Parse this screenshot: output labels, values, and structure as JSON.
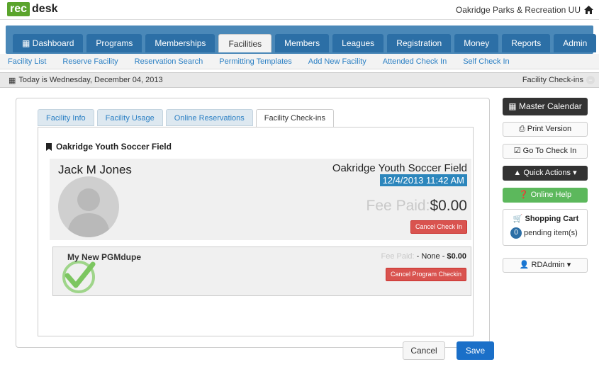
{
  "brand": {
    "rec": "rec",
    "desk": "desk"
  },
  "org": "Oakridge Parks & Recreation UU",
  "nav": {
    "tabs": [
      "Dashboard",
      "Programs",
      "Memberships",
      "Facilities",
      "Members",
      "Leagues",
      "Registration",
      "Money",
      "Reports",
      "Admin"
    ],
    "active": "Facilities"
  },
  "subnav": [
    "Facility List",
    "Reserve Facility",
    "Reservation Search",
    "Permitting Templates",
    "Add New Facility",
    "Attended Check In",
    "Self Check In"
  ],
  "datebar": {
    "today": "Today is Wednesday, December 04, 2013",
    "section": "Facility Check-ins"
  },
  "panel": {
    "tabs": [
      "Facility Info",
      "Facility Usage",
      "Online Reservations",
      "Facility Check-ins"
    ],
    "active_tab": "Facility Check-ins",
    "facility_title": "Oakridge Youth Soccer Field",
    "checkin": {
      "person": "Jack M Jones",
      "facility": "Oakridge Youth Soccer Field",
      "datetime": "12/4/2013 11:42 AM",
      "fee_label": "Fee Paid:",
      "fee_value": "$0.00",
      "cancel": "Cancel Check In"
    },
    "program": {
      "name": "My New PGMdupe",
      "fee_label": "Fee Paid:",
      "fee_none": "- None -",
      "fee_value": "$0.00",
      "cancel": "Cancel Program Checkin"
    },
    "buttons": {
      "cancel": "Cancel",
      "save": "Save"
    }
  },
  "sidebar": {
    "master": "Master Calendar",
    "print": "Print Version",
    "goto": "Go To Check In",
    "quick": "Quick Actions",
    "help": "Online Help",
    "cart_title": "Shopping Cart",
    "cart_count": "0",
    "cart_pending": "pending item(s)",
    "user": "RDAdmin"
  },
  "colors": {
    "nav": "#4a88b8",
    "tab": "#2c6fa6",
    "brand": "#5aa42c",
    "danger": "#d9534f",
    "primary": "#1a6fc8",
    "success": "#5cb85c"
  }
}
